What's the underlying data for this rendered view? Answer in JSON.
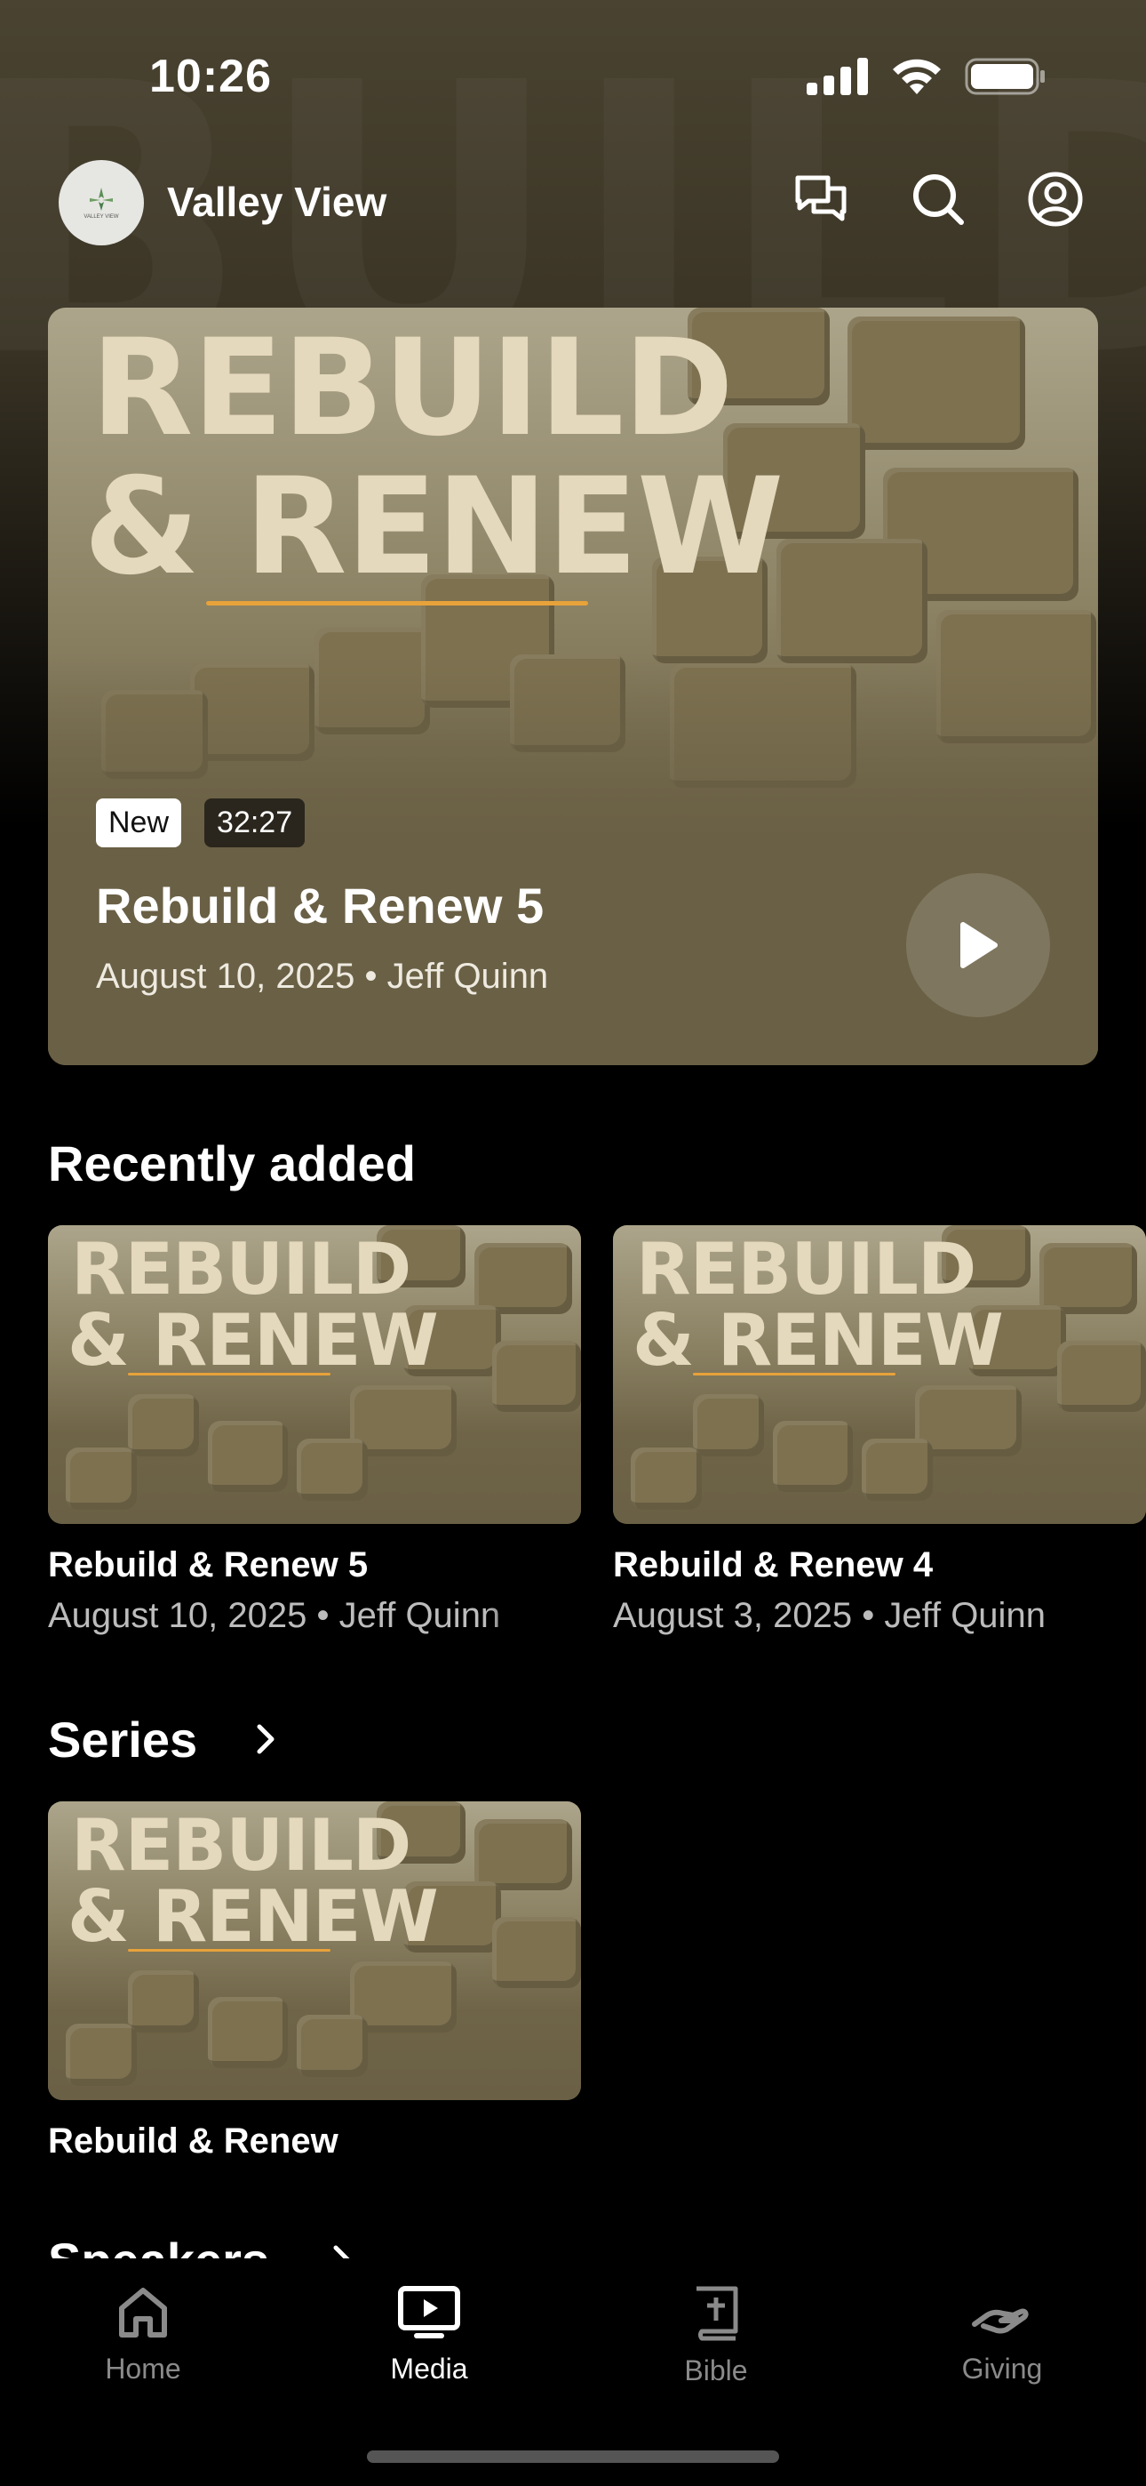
{
  "status_bar": {
    "time": "10:26"
  },
  "header": {
    "church_name": "Valley View",
    "logo_text": "VALLEY VIEW",
    "actions": [
      "chat-icon",
      "search-icon",
      "account-icon"
    ]
  },
  "hero": {
    "art_title_line1": "REBUILD",
    "art_title_line2": "& RENEW",
    "badge_new": "New",
    "duration": "32:27",
    "title": "Rebuild & Renew 5",
    "meta": "August 10, 2025 • Jeff Quinn"
  },
  "recently_added": {
    "heading": "Recently added",
    "items": [
      {
        "title": "Rebuild & Renew 5",
        "meta": "August 10, 2025 • Jeff Quinn"
      },
      {
        "title": "Rebuild & Renew 4",
        "meta": "August 3, 2025 • Jeff Quinn"
      }
    ]
  },
  "series": {
    "heading": "Series",
    "items": [
      {
        "title": "Rebuild & Renew"
      }
    ]
  },
  "speakers": {
    "heading": "Speakers"
  },
  "tab_bar": {
    "tabs": [
      {
        "label": "Home",
        "icon": "home-icon",
        "active": false
      },
      {
        "label": "Media",
        "icon": "tv-icon",
        "active": true
      },
      {
        "label": "Bible",
        "icon": "bible-icon",
        "active": false
      },
      {
        "label": "Giving",
        "icon": "giving-icon",
        "active": false
      }
    ]
  },
  "colors": {
    "accent_underline": "#e8a23a",
    "art_text": "#e4d8bd",
    "background": "#000000"
  }
}
